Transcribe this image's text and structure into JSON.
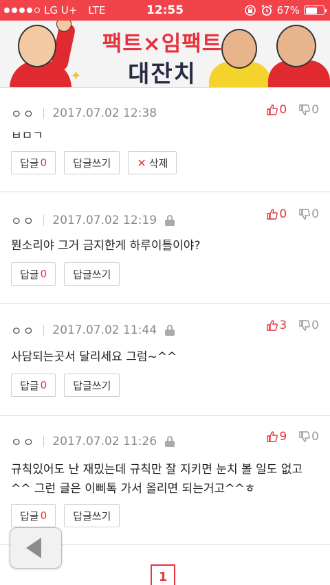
{
  "status_bar": {
    "carrier": "LG U+",
    "network": "LTE",
    "time": "12:55",
    "battery_percent": "67%",
    "battery_level": 0.67
  },
  "banner": {
    "title_line1": "팩트×임팩트",
    "title_line2": "대잔치"
  },
  "comments": [
    {
      "author": "ㅇㅇ",
      "date": "2017.07.02 12:38",
      "locked": false,
      "up": "0",
      "down": "0",
      "text": "ㅂㅁㄱ",
      "reply_label": "답글",
      "reply_count": "0",
      "write_reply_label": "답글쓰기",
      "delete_label": "삭제"
    },
    {
      "author": "ㅇㅇ",
      "date": "2017.07.02 12:19",
      "locked": true,
      "up": "0",
      "down": "0",
      "text": "뭔소리야 그거 금지한게 하루이틀이야?",
      "reply_label": "답글",
      "reply_count": "0",
      "write_reply_label": "답글쓰기"
    },
    {
      "author": "ㅇㅇ",
      "date": "2017.07.02 11:44",
      "locked": true,
      "up": "3",
      "down": "0",
      "text": "사담되는곳서 달리세요 그럼~^^",
      "reply_label": "답글",
      "reply_count": "0",
      "write_reply_label": "답글쓰기"
    },
    {
      "author": "ㅇㅇ",
      "date": "2017.07.02 11:26",
      "locked": true,
      "up": "9",
      "down": "0",
      "text_line1": "규칙있어도 난 재밌는데 규칙만 잘 지키면 눈치 볼 일도 없고",
      "text_line2": "^^ 그런 글은 이삐톡 가서 올리면 되는거고^^ㅎ",
      "reply_label": "답글",
      "reply_count": "0",
      "write_reply_label": "답글쓰기"
    }
  ],
  "pagination": {
    "current_page": "1"
  },
  "colors": {
    "accent": "#e6323c",
    "status_bar": "#f2434a"
  }
}
